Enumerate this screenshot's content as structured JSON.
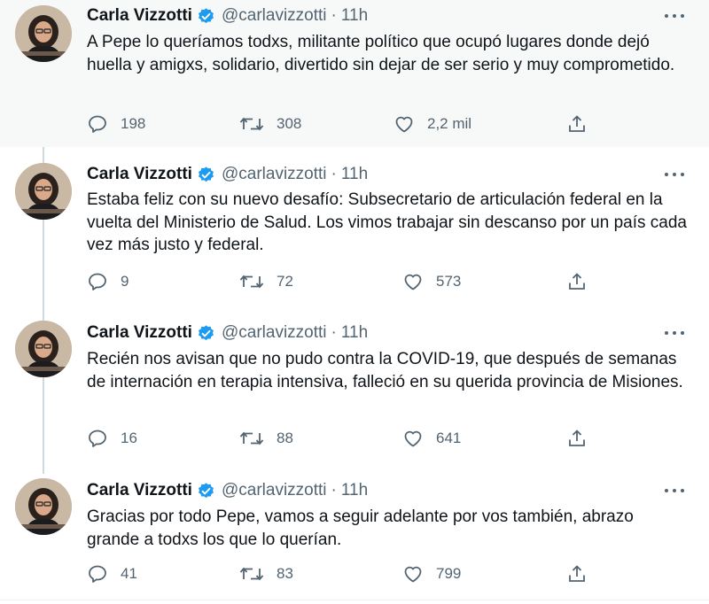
{
  "author": {
    "name": "Carla Vizzotti",
    "handle": "@carlavizzotti",
    "separator": "·",
    "time": "11h"
  },
  "tweets": [
    {
      "text": "A Pepe lo queríamos todxs, militante político que ocupó lugares donde dejó huella y amigxs, solidario, divertido sin dejar de ser serio y muy comprometido.",
      "replies": "198",
      "retweets": "308",
      "likes": "2,2 mil"
    },
    {
      "text": "Estaba feliz con su nuevo desafío: Subsecretario de articulación federal en la vuelta del Ministerio de Salud. Los vimos trabajar sin descanso por un país cada vez más justo y federal.",
      "replies": "9",
      "retweets": "72",
      "likes": "573"
    },
    {
      "text": "Recién nos avisan que no pudo contra la COVID-19, que después de semanas de internación en terapia intensiva, falleció en su querida provincia de Misiones.",
      "replies": "16",
      "retweets": "88",
      "likes": "641"
    },
    {
      "text": "Gracias por todo Pepe, vamos a seguir adelante por vos también, abrazo grande a todxs los que lo querían.",
      "replies": "41",
      "retweets": "83",
      "likes": "799"
    }
  ],
  "icons": {
    "reply": "reply-icon",
    "retweet": "retweet-icon",
    "like": "heart-icon",
    "share": "share-icon",
    "verified": "verified-badge-icon",
    "more": "more-options-icon"
  },
  "colors": {
    "text": "#0f1419",
    "secondary": "#536471",
    "verified": "#1d9bf0",
    "thread": "#cfd9de",
    "highlight_bg": "#f7f9f9"
  }
}
